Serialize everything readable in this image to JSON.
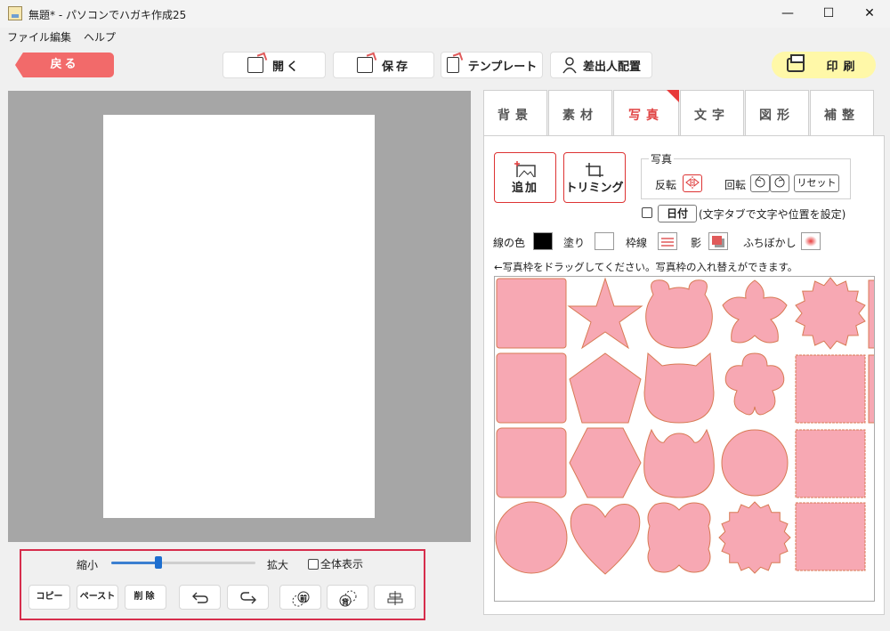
{
  "window": {
    "title": "無題* - パソコンでハガキ作成25",
    "minimize": "—",
    "maximize": "☐",
    "close": "✕"
  },
  "menu": [
    "ファイル",
    "編集",
    "ヘルプ"
  ],
  "toolbar": {
    "back": "戻る",
    "open": "開く",
    "save": "保存",
    "template": "テンプレート",
    "sender": "差出人配置",
    "print": "印刷"
  },
  "tabs": [
    "背景",
    "素材",
    "写真",
    "文字",
    "図形",
    "補整"
  ],
  "active_tab": "写真",
  "photo_panel": {
    "add": "追加",
    "trim": "トリミング",
    "group_title": "写真",
    "flip": "反転",
    "rotate": "回転",
    "reset": "リセット",
    "date_btn": "日付",
    "date_note": "(文字タブで文字や位置を設定)",
    "line_color": "線の色",
    "fill": "塗り",
    "frame_line": "枠線",
    "shadow": "影",
    "blur": "ふちぼかし",
    "hint": "←写真枠をドラッグしてください。写真枠の入れ替えができます。",
    "colors": {
      "line": "#000000",
      "fill": "#ffffff",
      "frame_fill": "#f7a8b3",
      "frame_stroke": "#d87a54",
      "accent": "#e03a3a"
    }
  },
  "bottom": {
    "shrink": "縮小",
    "enlarge": "拡大",
    "fit_all": "全体表示",
    "zoom_level_fraction": 0.33,
    "copy": "コピー",
    "paste": "ペースト",
    "delete": "削除"
  }
}
